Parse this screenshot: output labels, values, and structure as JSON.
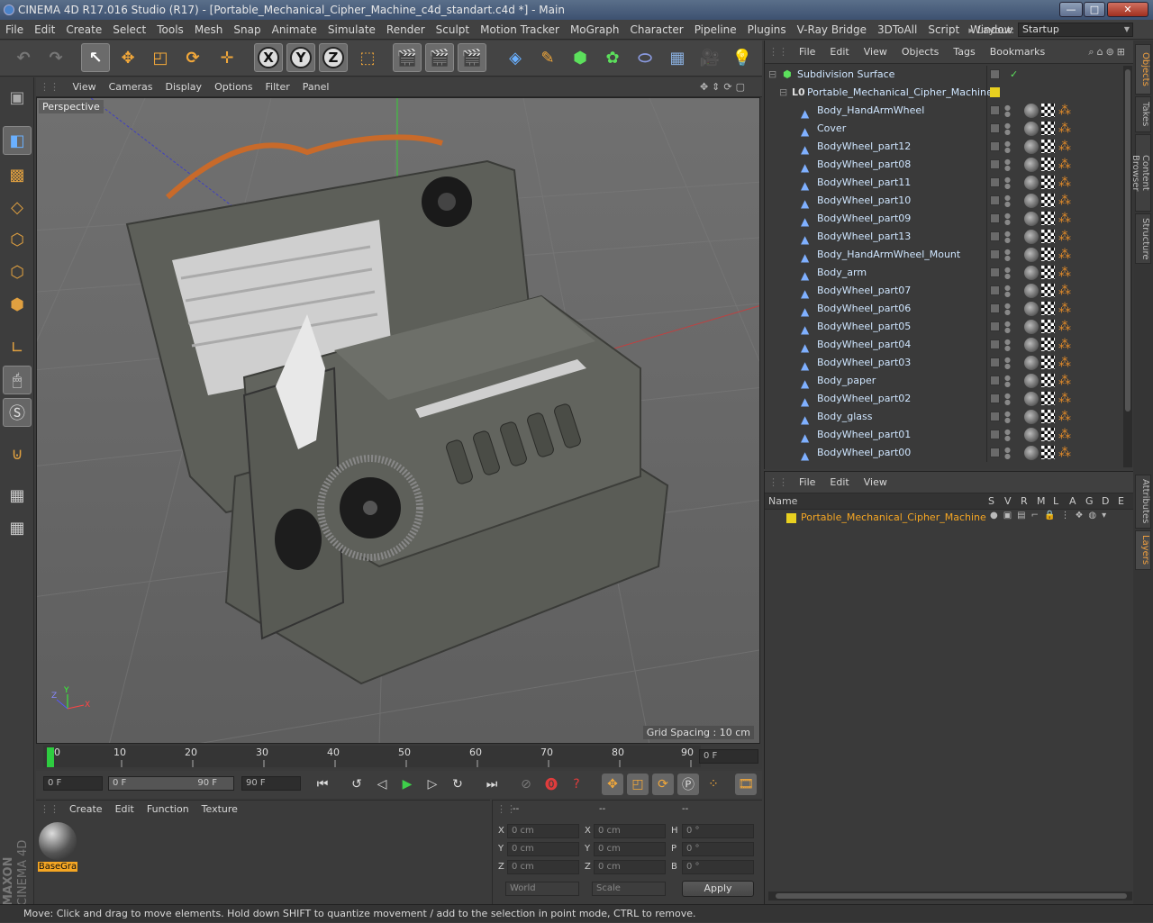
{
  "window": {
    "title": "CINEMA 4D R17.016 Studio (R17) - [Portable_Mechanical_Cipher_Machine_c4d_standart.c4d *] - Main"
  },
  "menu": [
    "File",
    "Edit",
    "Create",
    "Select",
    "Tools",
    "Mesh",
    "Snap",
    "Animate",
    "Simulate",
    "Render",
    "Sculpt",
    "Motion Tracker",
    "MoGraph",
    "Character",
    "Pipeline",
    "Plugins",
    "V-Ray Bridge",
    "3DToAll",
    "Script",
    "Window"
  ],
  "layout": {
    "label": "Layout:",
    "value": "Startup"
  },
  "toolbar": {
    "x": "X",
    "y": "Y",
    "z": "Z"
  },
  "viewport": {
    "menu": [
      "View",
      "Cameras",
      "Display",
      "Options",
      "Filter",
      "Panel"
    ],
    "label": "Perspective",
    "grid": "Grid Spacing : 10 cm"
  },
  "timeline": {
    "ticks": [
      "0",
      "10",
      "20",
      "30",
      "40",
      "50",
      "60",
      "70",
      "80",
      "90"
    ],
    "frame_field": "0 F"
  },
  "transport": {
    "start": "0 F",
    "range_start": "0 F",
    "range_end": "90 F",
    "end": "90 F"
  },
  "materials": {
    "menu": [
      "Create",
      "Edit",
      "Function",
      "Texture"
    ],
    "items": [
      {
        "name": "BaseGra"
      }
    ]
  },
  "coords": {
    "rows": [
      {
        "a": "X",
        "av": "0 cm",
        "b": "X",
        "bv": "0 cm",
        "c": "H",
        "cv": "0 °"
      },
      {
        "a": "Y",
        "av": "0 cm",
        "b": "Y",
        "bv": "0 cm",
        "c": "P",
        "cv": "0 °"
      },
      {
        "a": "Z",
        "av": "0 cm",
        "b": "Z",
        "bv": "0 cm",
        "c": "B",
        "cv": "0 °"
      }
    ],
    "dash": "--",
    "space": "World",
    "mode": "Scale",
    "apply": "Apply"
  },
  "status": "Move: Click and drag to move elements. Hold down SHIFT to quantize movement / add to the selection in point mode, CTRL to remove.",
  "objects": {
    "menu": [
      "File",
      "Edit",
      "View",
      "Objects",
      "Tags",
      "Bookmarks"
    ],
    "root": "Subdivision Surface",
    "group": "Portable_Mechanical_Cipher_Machine",
    "items": [
      "Body_HandArmWheel",
      "Cover",
      "BodyWheel_part12",
      "BodyWheel_part08",
      "BodyWheel_part11",
      "BodyWheel_part10",
      "BodyWheel_part09",
      "BodyWheel_part13",
      "Body_HandArmWheel_Mount",
      "Body_arm",
      "BodyWheel_part07",
      "BodyWheel_part06",
      "BodyWheel_part05",
      "BodyWheel_part04",
      "BodyWheel_part03",
      "Body_paper",
      "BodyWheel_part02",
      "Body_glass",
      "BodyWheel_part01",
      "BodyWheel_part00"
    ]
  },
  "layers": {
    "menu": [
      "File",
      "Edit",
      "View"
    ],
    "columns": [
      "Name",
      "S",
      "V",
      "R",
      "M",
      "L",
      "A",
      "G",
      "D",
      "E"
    ],
    "rows": [
      {
        "name": "Portable_Mechanical_Cipher_Machine",
        "color": "#e8d020"
      }
    ]
  },
  "right_tabs": [
    "Objects",
    "Takes",
    "Content Browser",
    "Structure",
    "Attributes",
    "Layers"
  ],
  "brand": {
    "top": "MAXON",
    "bottom": "CINEMA 4D"
  },
  "colors": {
    "accent": "#f0a040",
    "selected": "#f5a623"
  }
}
